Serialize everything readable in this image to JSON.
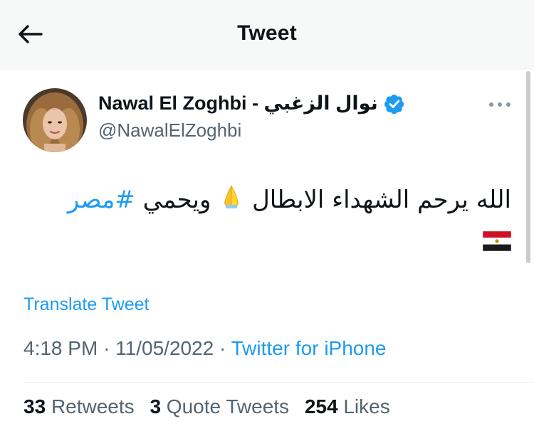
{
  "header": {
    "title": "Tweet"
  },
  "tweet": {
    "author": {
      "display_name": "Nawal El Zoghbi - نوال الزغبي",
      "handle": "@NawalElZoghbi",
      "verified": true
    },
    "text_line1": "الله يرحم الشهداء الابطال",
    "emoji_hands": "folded-hands-emoji",
    "text_line1_after": "ويحمي",
    "hashtag": "#مصر",
    "emoji_flag": "egypt-flag-emoji",
    "translate_label": "Translate Tweet",
    "time": "4:18 PM",
    "date": "11/05/2022",
    "separator": "·",
    "source": "Twitter for iPhone",
    "stats": {
      "retweets_count": "33",
      "retweets_label": "Retweets",
      "quotes_count": "3",
      "quotes_label": "Quote Tweets",
      "likes_count": "254",
      "likes_label": "Likes"
    }
  },
  "colors": {
    "accent": "#1d9bf0",
    "text_primary": "#0f1419",
    "text_secondary": "#536471",
    "header_bg": "#f7f9f9"
  },
  "icons": {
    "back": "back-arrow-icon",
    "verified": "verified-badge-icon",
    "more": "more-options-icon"
  }
}
